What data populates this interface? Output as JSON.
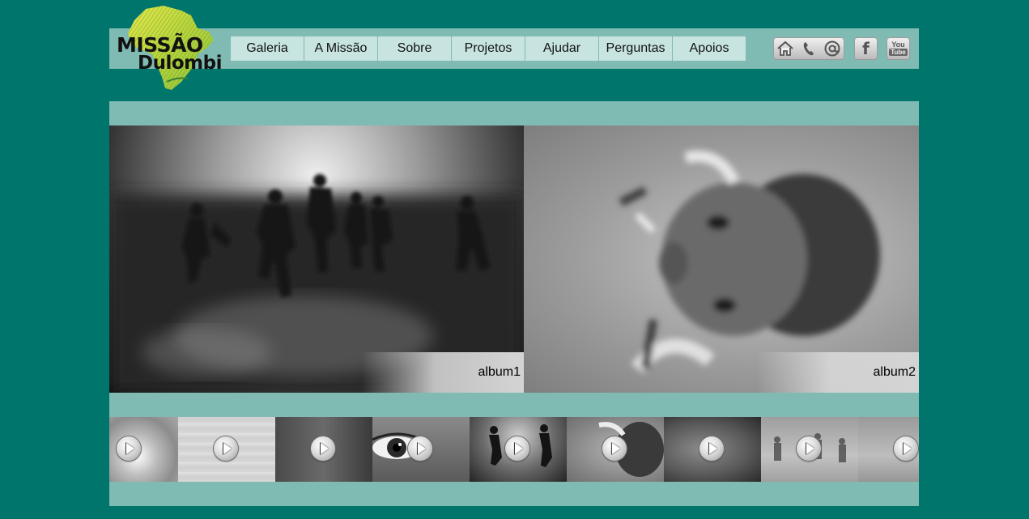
{
  "logo": {
    "line1": "MISSÃO",
    "line2": "Dulombi"
  },
  "nav": {
    "items": [
      {
        "label": "Galeria"
      },
      {
        "label": "A Missão"
      },
      {
        "label": "Sobre"
      },
      {
        "label": "Projetos"
      },
      {
        "label": "Ajudar"
      },
      {
        "label": "Perguntas"
      },
      {
        "label": "Apoios"
      }
    ]
  },
  "social": {
    "icons": [
      "home-icon",
      "phone-icon",
      "at-icon",
      "facebook-icon",
      "youtube-icon"
    ],
    "youtube_text_top": "You",
    "youtube_text_bottom": "Tube",
    "facebook_letter": "f"
  },
  "gallery": {
    "albums": [
      {
        "caption": "album1"
      },
      {
        "caption": "album2"
      }
    ],
    "thumbnails_count": 9
  },
  "colors": {
    "page_background": "#00756b",
    "bar": "#7fbab3",
    "nav_button": "#c7e4e0",
    "logo_accent": "#c8d832"
  }
}
